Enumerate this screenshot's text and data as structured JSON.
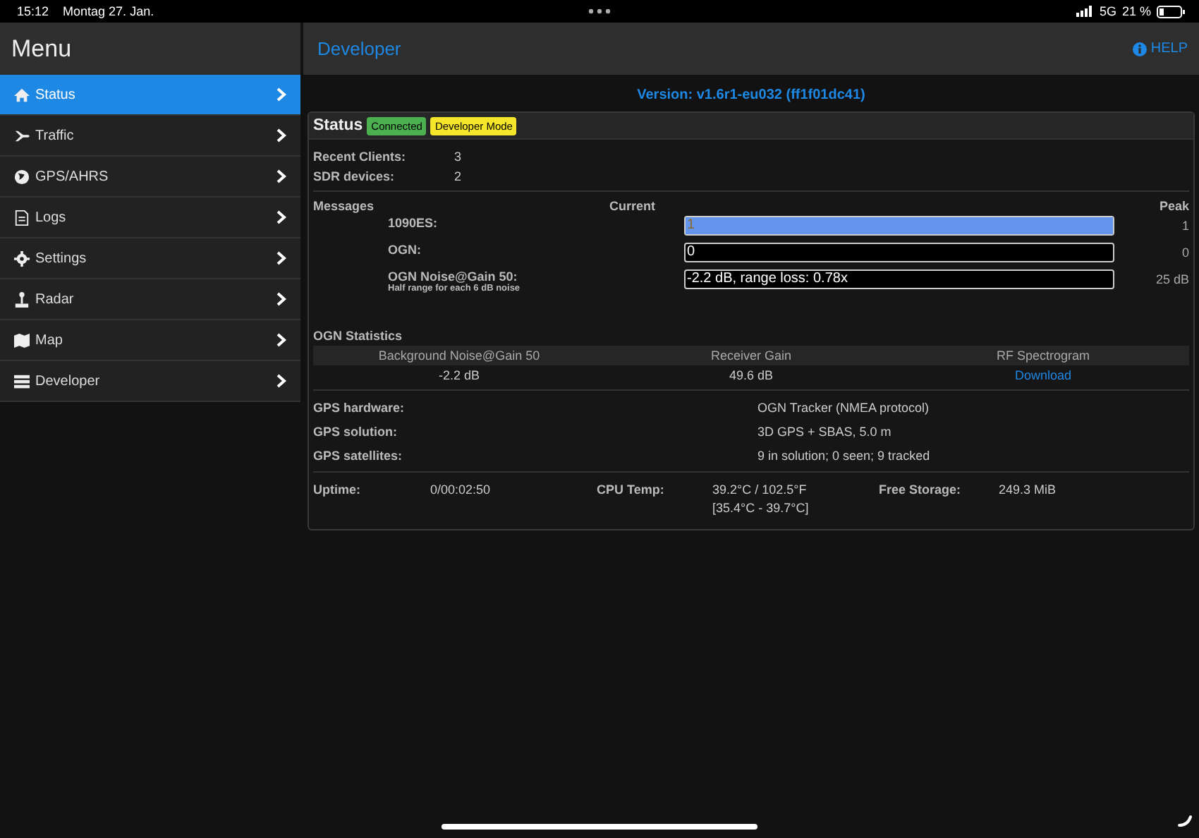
{
  "status_bar": {
    "time": "15:12",
    "date": "Montag 27. Jan.",
    "network": "5G",
    "battery": "21 %"
  },
  "sidebar": {
    "title": "Menu",
    "items": [
      {
        "label": "Status",
        "selected": true
      },
      {
        "label": "Traffic",
        "selected": false
      },
      {
        "label": "GPS/AHRS",
        "selected": false
      },
      {
        "label": "Logs",
        "selected": false
      },
      {
        "label": "Settings",
        "selected": false
      },
      {
        "label": "Radar",
        "selected": false
      },
      {
        "label": "Map",
        "selected": false
      },
      {
        "label": "Developer",
        "selected": false
      }
    ]
  },
  "header": {
    "title": "Developer",
    "help": "HELP"
  },
  "version": "Version: v1.6r1-eu032 (ff1f01dc41)",
  "panel": {
    "title": "Status",
    "badges": [
      {
        "label": "Connected",
        "color": "#4caf50"
      },
      {
        "label": "Developer Mode",
        "color": "#f5e62b"
      }
    ],
    "info": [
      {
        "label": "Recent Clients:",
        "value": "3"
      },
      {
        "label": "SDR devices:",
        "value": "2"
      }
    ],
    "messages": {
      "heading": "Messages",
      "current": "Current",
      "peak": "Peak",
      "rows": [
        {
          "label": "1090ES:",
          "reading": "1",
          "level": 1,
          "peak": "1"
        },
        {
          "label": "OGN:",
          "reading": "0",
          "level": 0,
          "peak": "0"
        },
        {
          "label": "OGN Noise@Gain 50:",
          "note": "Half range for each 6 dB noise",
          "reading": "-2.2 dB, range loss: 0.78x",
          "level": 0,
          "peak": "25 dB"
        }
      ]
    },
    "ogn": {
      "heading": "OGN Statistics",
      "columns": [
        "Background Noise@Gain 50",
        "Receiver Gain",
        "RF Spectrogram"
      ],
      "values": [
        "-2.2 dB",
        "49.6 dB"
      ],
      "link": "Download"
    },
    "gps": [
      {
        "label": "GPS hardware:",
        "value": "OGN Tracker (NMEA protocol)"
      },
      {
        "label": "GPS solution:",
        "value": "3D GPS + SBAS, 5.0 m"
      },
      {
        "label": "GPS satellites:",
        "value": "9 in solution; 0 seen; 9 tracked"
      }
    ],
    "footer": [
      {
        "label": "Uptime:",
        "value": "0/00:02:50"
      },
      {
        "label": "CPU Temp:",
        "value": "39.2°C / 102.5°F",
        "extra": "[35.4°C - 39.7°C]"
      },
      {
        "label": "Free Storage:",
        "value": "249.3 MiB"
      }
    ]
  }
}
